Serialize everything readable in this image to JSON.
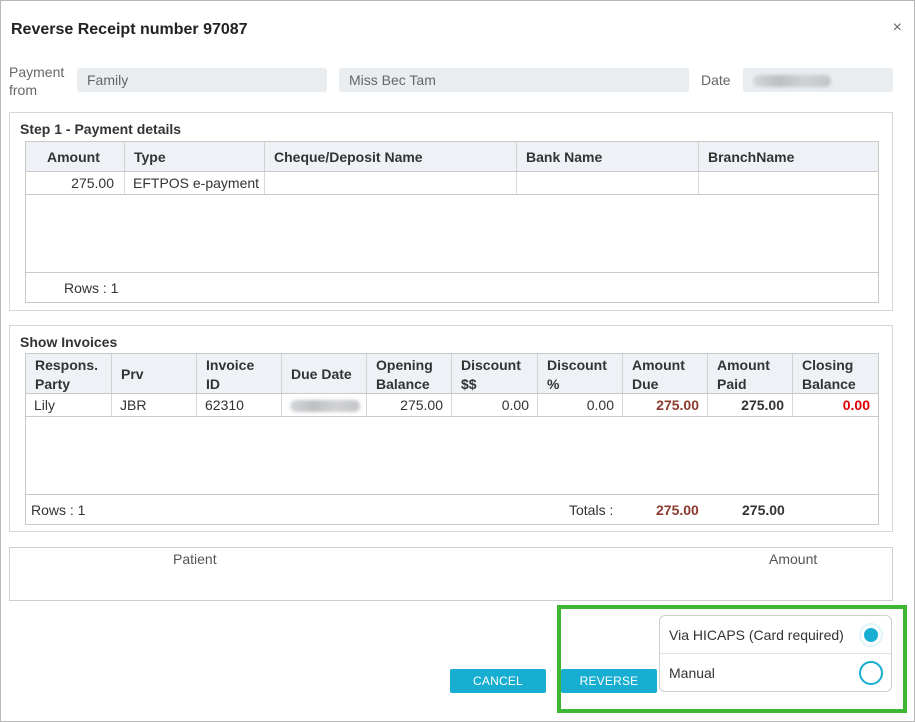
{
  "dialog": {
    "title": "Reverse Receipt number 97087",
    "close_icon": "close-icon",
    "close_glyph": "×"
  },
  "header": {
    "payment_from_label_line1": "Payment",
    "payment_from_label_line2": "from",
    "payer_type": "Family",
    "payer_name": "Miss Bec  Tam",
    "date_label": "Date"
  },
  "payment_details": {
    "title": "Step 1 - Payment details",
    "columns": [
      "Amount",
      "Type",
      "Cheque/Deposit Name",
      "Bank Name",
      "BranchName"
    ],
    "rows": [
      {
        "amount": "275.00",
        "type": "EFTPOS e-payment",
        "cheque": "",
        "bank": "",
        "branch": ""
      }
    ],
    "rows_count": "Rows : 1"
  },
  "invoices": {
    "title": "Show Invoices",
    "columns": [
      [
        "Respons.",
        "Party"
      ],
      [
        "Prv",
        ""
      ],
      [
        "Invoice",
        "ID"
      ],
      [
        "Due Date",
        ""
      ],
      [
        "Opening",
        "Balance"
      ],
      [
        "Discount",
        "$$"
      ],
      [
        "Discount",
        "%"
      ],
      [
        "Amount",
        "Due"
      ],
      [
        "Amount",
        "Paid"
      ],
      [
        "Closing",
        "Balance"
      ]
    ],
    "rows": [
      {
        "party": "Lily",
        "prv": "JBR",
        "invoice_id": "62310",
        "opening": "275.00",
        "disc_amt": "0.00",
        "disc_pct": "0.00",
        "amount_due": "275.00",
        "amount_paid": "275.00",
        "closing": "0.00"
      }
    ],
    "rows_count": "Rows : 1",
    "totals_label": "Totals :",
    "total_due": "275.00",
    "total_paid": "275.00"
  },
  "patient_table": {
    "patient_header": "Patient",
    "amount_header": "Amount"
  },
  "buttons": {
    "cancel": "CANCEL",
    "reverse": "REVERSE"
  },
  "reverse_options": {
    "items": [
      {
        "label": "Via HICAPS (Card required)",
        "selected": true
      },
      {
        "label": "Manual",
        "selected": false
      }
    ]
  },
  "colors": {
    "accent": "#17aed2",
    "amount_due": "#8b3a2e",
    "closing_zero": "#e00000",
    "highlight": "#3fb534"
  }
}
